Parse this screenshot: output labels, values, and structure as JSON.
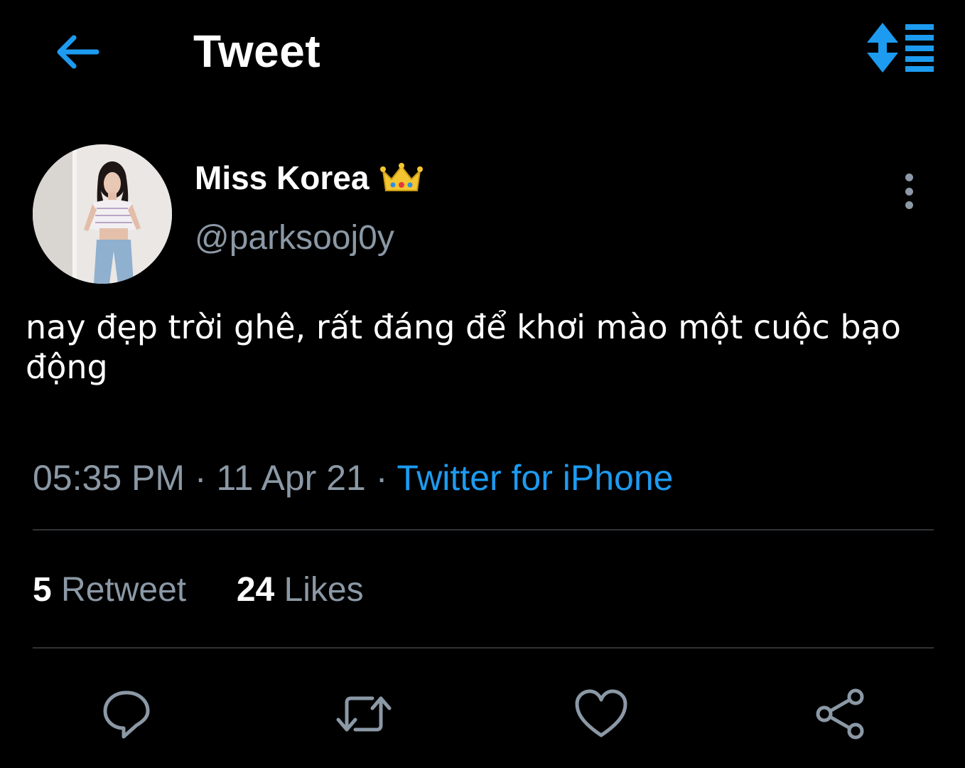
{
  "header": {
    "back_icon": "arrow-left-icon",
    "title": "Tweet",
    "sort_icon": "sort-list-icon"
  },
  "author": {
    "display_name": "Miss Korea",
    "badge_icon": "crown-icon",
    "handle": "@parksooj0y",
    "more_icon": "more-vertical-icon"
  },
  "tweet": {
    "text": "nay đẹp trời ghê, rất đáng để khơi mào một cuộc bạo động",
    "time": "05:35 PM",
    "date": "11 Apr 21",
    "separator": "·",
    "source": "Twitter for iPhone"
  },
  "stats": {
    "retweets_count": "5",
    "retweets_label": "Retweet",
    "likes_count": "24",
    "likes_label": "Likes"
  },
  "actions": {
    "reply_icon": "reply-icon",
    "retweet_icon": "retweet-icon",
    "like_icon": "heart-icon",
    "share_icon": "share-icon"
  },
  "colors": {
    "background": "#000000",
    "accent": "#1d9bf0",
    "secondary_text": "#8b98a5",
    "divider": "#2f3336"
  }
}
